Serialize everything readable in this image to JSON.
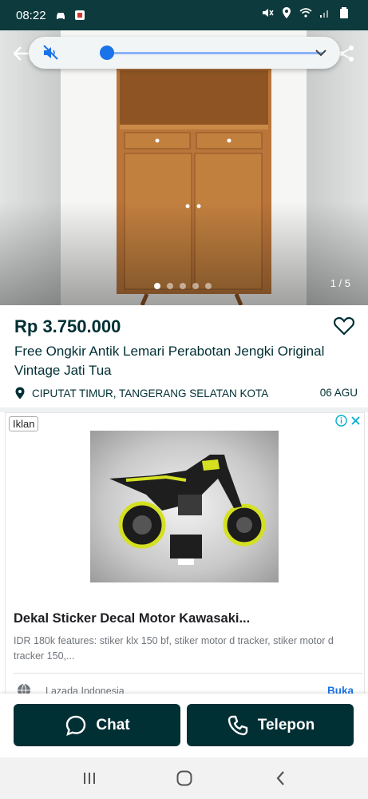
{
  "status_bar": {
    "time": "08:22"
  },
  "photo": {
    "counter": "1 / 5",
    "slide_count": 5,
    "active_slide": 1
  },
  "volume": {
    "level": 0.0
  },
  "listing": {
    "price": "Rp 3.750.000",
    "title": "Free Ongkir Antik Lemari Perabotan Jengki Original Vintage Jati Tua",
    "location": "CIPUTAT TIMUR, TANGERANG SELATAN KOTA",
    "date": "06 AGU"
  },
  "ad": {
    "badge": "Iklan",
    "title": "Dekal Sticker Decal Motor Kawasaki...",
    "description": "IDR 180k features: stiker klx 150 bf, stiker motor d tracker, stiker motor d tracker 150,...",
    "source": "Lazada Indonesia",
    "open_label": "Buka"
  },
  "actions": {
    "chat_label": "Chat",
    "call_label": "Telepon"
  },
  "colors": {
    "primary": "#002f34",
    "status_bar": "#0d3a3c",
    "link": "#1a73e8"
  }
}
